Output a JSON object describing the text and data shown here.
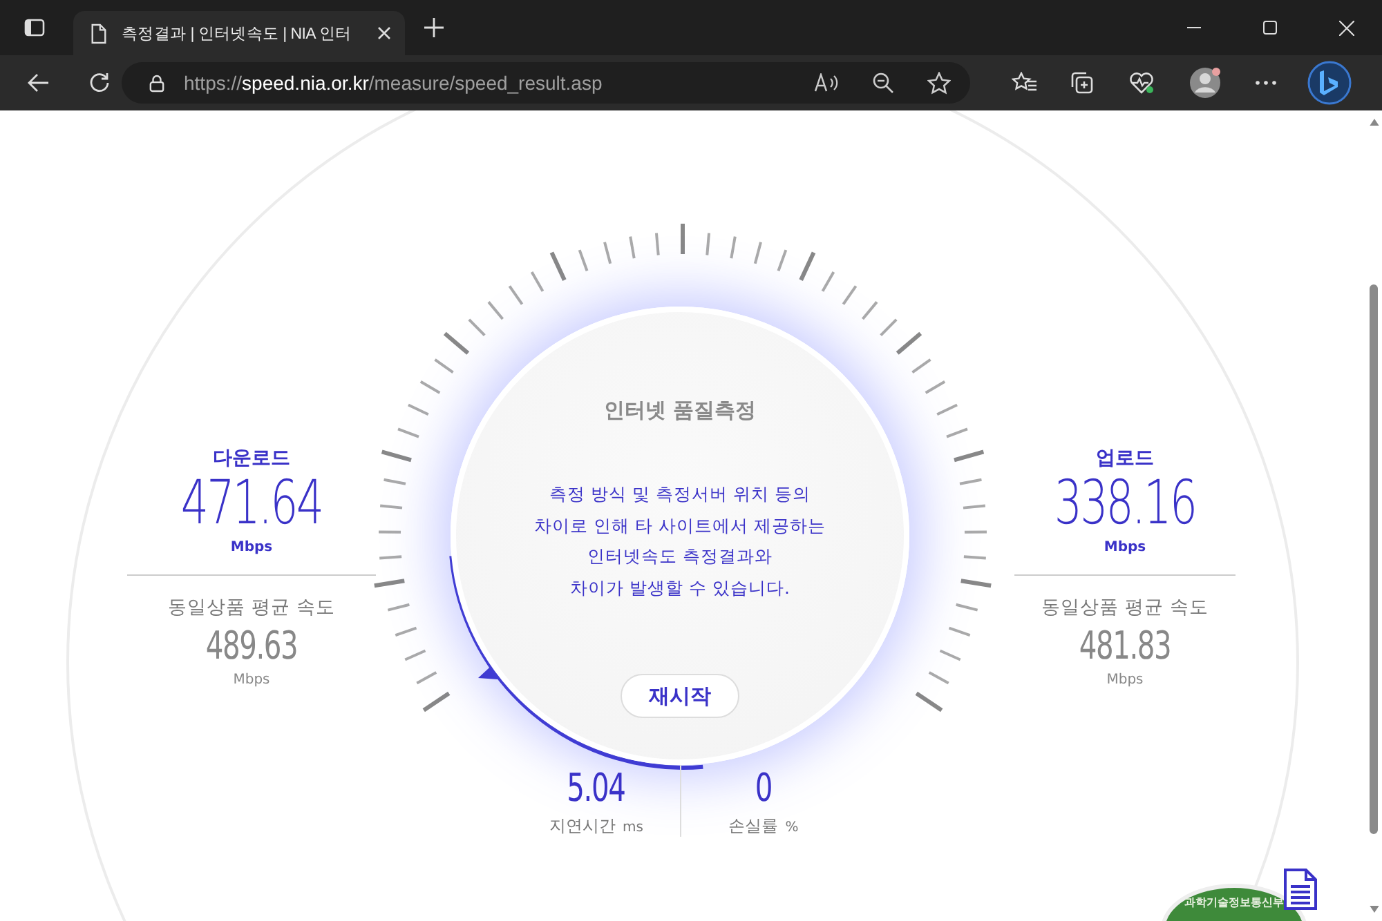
{
  "browser": {
    "tab": {
      "title": "측정결과 | 인터넷속도 | NIA 인터"
    },
    "address": {
      "scheme": "https://",
      "host": "speed.nia.or.kr",
      "path": "/measure/speed_result.asp"
    }
  },
  "sides": [
    {
      "label": "다운로드",
      "value": "471.64",
      "unit": "Mbps",
      "avg_label": "동일상품 평균 속도",
      "avg_value": "489.63",
      "avg_unit": "Mbps"
    },
    {
      "label": "업로드",
      "value": "338.16",
      "unit": "Mbps",
      "avg_label": "동일상품 평균 속도",
      "avg_value": "481.83",
      "avg_unit": "Mbps"
    }
  ],
  "gauge": {
    "title": "인터넷 품질측정",
    "notice": [
      "측정 방식 및 측정서버 위치 등의",
      "차이로 인해 타 사이트에서 제공하는",
      "인터넷속도 측정결과와",
      "차이가 발생할 수 있습니다."
    ],
    "restart_button": "재시작"
  },
  "metrics": [
    {
      "value": "5.04",
      "label": "지연시간",
      "unit": "ms"
    },
    {
      "value": "0",
      "label": "손실률",
      "unit": "%"
    }
  ],
  "seal": {
    "text": "과학기술정보통신부"
  }
}
